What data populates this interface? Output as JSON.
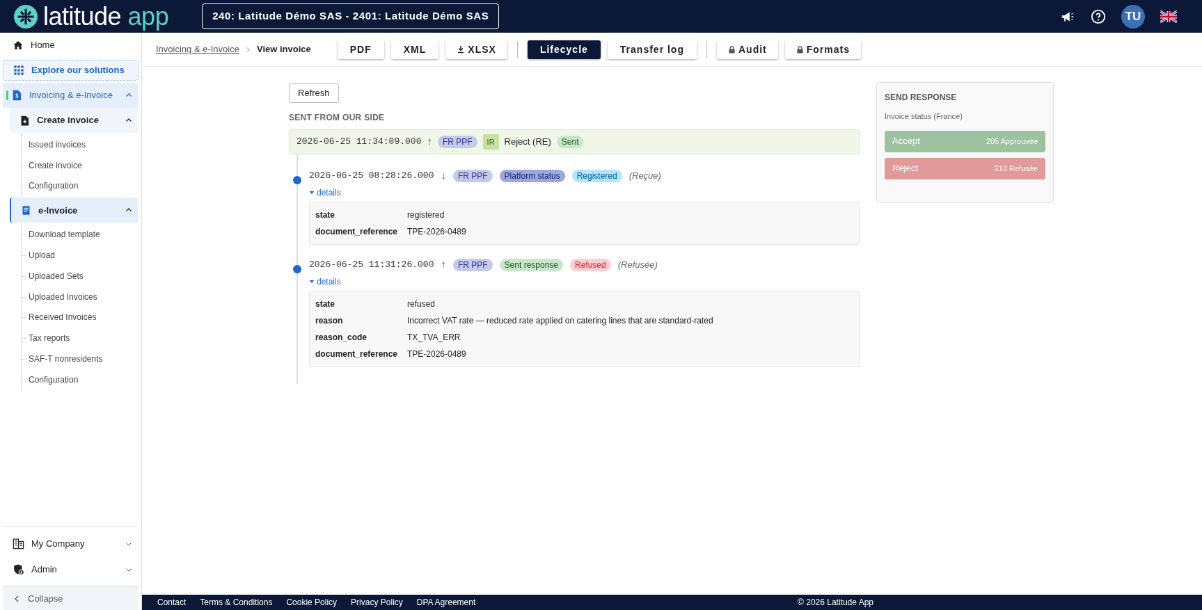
{
  "header": {
    "logo_main": "latitude",
    "logo_accent": "app",
    "company": "240: Latitude Démo SAS - 2401: Latitude Démo SAS",
    "avatar": "TU"
  },
  "sidebar": {
    "items": [
      {
        "label": "Home",
        "kind": "link",
        "selected": false
      },
      {
        "label": "Explore our solutions",
        "kind": "explore",
        "selected": false
      },
      {
        "label": "Invoicing & e-Invoice",
        "kind": "section",
        "selected": true,
        "expanded": true,
        "children": [
          {
            "label": "Create invoice",
            "selected": false,
            "expanded": true,
            "children": [
              {
                "label": "Issued invoices"
              },
              {
                "label": "Create invoice"
              },
              {
                "label": "Configuration"
              }
            ]
          },
          {
            "label": "e-Invoice",
            "selected": true,
            "expanded": true,
            "children": [
              {
                "label": "Download template"
              },
              {
                "label": "Upload"
              },
              {
                "label": "Uploaded Sets"
              },
              {
                "label": "Uploaded Invoices"
              },
              {
                "label": "Received Invoices"
              },
              {
                "label": "Tax reports"
              },
              {
                "label": "SAF-T nonresidents"
              },
              {
                "label": "Configuration"
              }
            ]
          }
        ]
      }
    ],
    "bottom": [
      {
        "label": "My Company",
        "expanded": false
      },
      {
        "label": "Admin",
        "expanded": false
      }
    ],
    "collapse": "Collapse"
  },
  "breadcrumb": {
    "parent": "Invoicing & e-Invoice",
    "current": "View invoice"
  },
  "toolbar": [
    [
      {
        "label": "PDF",
        "kind": "plain",
        "selected": false
      },
      {
        "label": "XML",
        "kind": "plain",
        "selected": false
      },
      {
        "label": "XLSX",
        "kind": "download",
        "selected": false
      }
    ],
    [
      {
        "label": "Lifecycle",
        "kind": "plain",
        "selected": true
      },
      {
        "label": "Transfer log",
        "kind": "plain",
        "selected": false
      }
    ],
    [
      {
        "label": "Audit",
        "kind": "locked",
        "selected": false
      },
      {
        "label": "Formats",
        "kind": "locked",
        "selected": false
      }
    ]
  ],
  "refresh": "Refresh",
  "sent": {
    "title": "SENT FROM OUR SIDE",
    "time": "2026-06-25 11:34:09.000",
    "arrow": "↑",
    "outgoing": true,
    "tags": [
      {
        "text": "FR PPF",
        "kind": "platform"
      },
      {
        "text": "IR",
        "kind": "code"
      }
    ],
    "label": "Reject (RE)",
    "status": {
      "text": "Sent",
      "kind": "success"
    }
  },
  "events": [
    {
      "time": "2026-06-25 08:28:26.000",
      "arrow": "↓",
      "outgoing": false,
      "tags": [
        {
          "text": "FR PPF",
          "kind": "platform"
        },
        {
          "text": "Platform status",
          "kind": "type"
        },
        {
          "text": "Registered",
          "kind": "info"
        }
      ],
      "note": "(Reçue)",
      "details": "details",
      "expanded": true,
      "fields": [
        {
          "key": "state",
          "value": "registered"
        },
        {
          "key": "document_reference",
          "value": "TPE-2026-0489"
        }
      ]
    },
    {
      "time": "2026-06-25 11:31:26.000",
      "arrow": "↑",
      "outgoing": true,
      "tags": [
        {
          "text": "FR PPF",
          "kind": "platform"
        },
        {
          "text": "Sent response",
          "kind": "success"
        },
        {
          "text": "Refused",
          "kind": "danger"
        }
      ],
      "note": "(Refusée)",
      "details": "details",
      "expanded": true,
      "fields": [
        {
          "key": "state",
          "value": "refused"
        },
        {
          "key": "reason",
          "value": "Incorrect VAT rate — reduced rate applied on catering lines that are standard-rated"
        },
        {
          "key": "reason_code",
          "value": "TX_TVA_ERR"
        },
        {
          "key": "document_reference",
          "value": "TPE-2026-0489"
        }
      ]
    }
  ],
  "response": {
    "title": "SEND RESPONSE",
    "subtitle": "Invoice status (France)",
    "actions": [
      {
        "label": "Accept",
        "code": "205 Approuvée",
        "kind": "accept"
      },
      {
        "label": "Reject",
        "code": "210 Refusée",
        "kind": "reject"
      }
    ]
  },
  "footer": {
    "links": [
      "Contact",
      "Terms & Conditions",
      "Cookie Policy",
      "Privacy Policy",
      "DPA Agreement"
    ],
    "copyright": "© 2026 Latitude App"
  }
}
